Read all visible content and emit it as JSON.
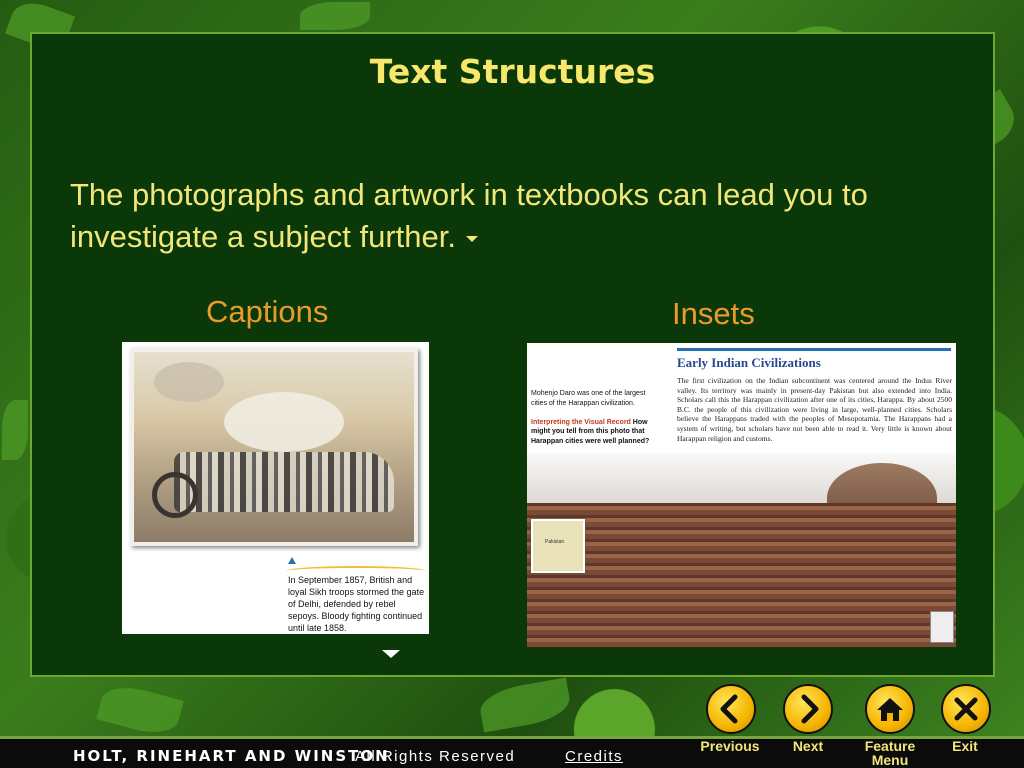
{
  "slide": {
    "title": "Text Structures",
    "body": "The photographs and artwork in textbooks can lead you to investigate a subject further.",
    "label_left": "Captions",
    "label_right": "Insets"
  },
  "left_image": {
    "caption": "In September 1857, British and loyal Sikh troops stormed the gate of Delhi, defended by rebel sepoys. Bloody fighting continued until late 1858."
  },
  "right_image": {
    "title": "Early Indian Civilizations",
    "paragraph": "The first civilization on the Indian subcontinent was centered around the Indus River valley. Its territory was mainly in present-day Pakistan but also extended into India. Scholars call this the Harappan civilization after one of its cities, Harappa. By about 2500 B.C. the people of this civilization were living in large, well-planned cities. Scholars believe the Harappans traded with the peoples of Mesopotamia. The Harappans had a system of writing, but scholars have not been able to read it. Very little is known about Harappan religion and customs.",
    "side_caption": "Mohenjo Daro was one of the largest cities of the Harappan civilization.",
    "side_prompt_label": "Interpreting the Visual Record",
    "side_prompt_text": "How might you tell from this photo that Harappan cities were well planned?",
    "map_label": "Pakistan"
  },
  "footer": {
    "publisher": "HOLT, RINEHART AND WINSTON",
    "rights": "All Rights Reserved",
    "credits": "Credits"
  },
  "nav": {
    "previous": "Previous",
    "next": "Next",
    "feature_menu_1": "Feature",
    "feature_menu_2": "Menu",
    "exit": "Exit"
  },
  "colors": {
    "slide_bg": "#0a3809",
    "title": "#f7e76a",
    "label": "#ec9a2a",
    "button": "#f5b400"
  },
  "icons": [
    "chevron-left-icon",
    "chevron-right-icon",
    "home-icon",
    "close-icon",
    "triangle-down-icon"
  ]
}
